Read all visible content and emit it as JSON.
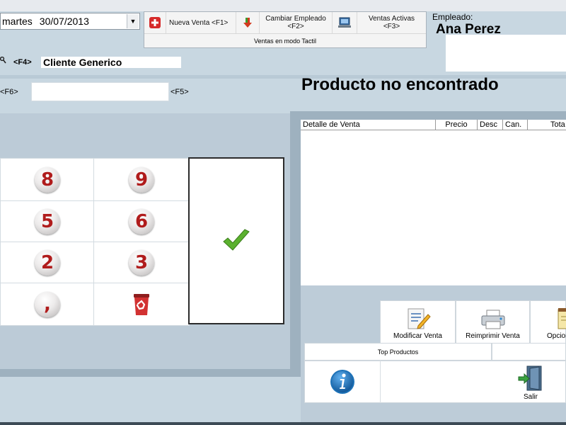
{
  "header": {
    "day": "martes",
    "date": "30/07/2013"
  },
  "toolbar": {
    "new_sale": "Nueva Venta <F1>",
    "change_employee_1": "Cambiar Empleado",
    "change_employee_2": "<F2>",
    "active_sales": "Ventas Activas <F3>",
    "touch_mode": "Ventas en modo Tactil"
  },
  "employee": {
    "label": "Empleado:",
    "name": "Ana Perez"
  },
  "client": {
    "shortcut": "<F4>",
    "name": "Cliente Generico"
  },
  "search": {
    "shortcut_left": "<F6>",
    "shortcut_right": "<F5>",
    "value": ""
  },
  "message": "Producto no encontrado",
  "keypad": {
    "keys": [
      "8",
      "9",
      "5",
      "6",
      "2",
      "3",
      ","
    ]
  },
  "detail": {
    "columns": [
      "Detalle de Venta",
      "Precio",
      "Desc",
      "Can.",
      "Tota"
    ]
  },
  "actions": {
    "modify": "Modificar Venta",
    "reprint": "Reimprimir Venta",
    "options": "Opcion",
    "top_products": "Top Productos",
    "exit": "Salir"
  },
  "colors": {
    "background": "#c8d7e1",
    "key_digit": "#b01c1c",
    "check": "#5bb12f",
    "info": "#1d72b8"
  }
}
